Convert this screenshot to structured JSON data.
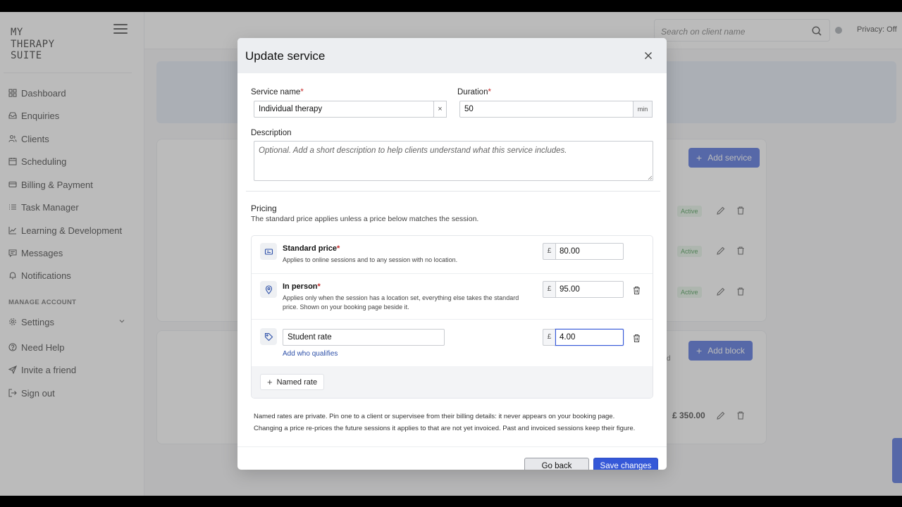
{
  "sidebar": {
    "logo": "MY\nTHERAPY\nSUITE",
    "items": [
      {
        "label": "Dashboard",
        "icon": "grid-icon"
      },
      {
        "label": "Enquiries",
        "icon": "inbox-icon"
      },
      {
        "label": "Clients",
        "icon": "users-icon"
      },
      {
        "label": "Scheduling",
        "icon": "calendar-icon"
      },
      {
        "label": "Billing & Payment",
        "icon": "card-icon"
      },
      {
        "label": "Task Manager",
        "icon": "list-icon"
      },
      {
        "label": "Learning & Development",
        "icon": "chart-icon"
      },
      {
        "label": "Messages",
        "icon": "message-icon"
      },
      {
        "label": "Notifications",
        "icon": "bell-icon"
      }
    ],
    "manage_label": "MANAGE ACCOUNT",
    "account_items": [
      {
        "label": "Settings",
        "icon": "gear-icon"
      },
      {
        "label": "Need Help",
        "icon": "help-icon"
      },
      {
        "label": "Invite a friend",
        "icon": "send-icon"
      },
      {
        "label": "Sign out",
        "icon": "logout-icon"
      }
    ]
  },
  "topbar": {
    "search_placeholder": "Search on client name",
    "privacy": "Privacy: Off"
  },
  "background": {
    "add_service": "Add service",
    "add_block": "Add block",
    "badges": [
      "Active",
      "Active",
      "Active"
    ],
    "price": "£ 350.00",
    "partial_text": "d"
  },
  "modal": {
    "title": "Update service",
    "service_name_label": "Service name",
    "service_name_value": "Individual therapy",
    "duration_label": "Duration",
    "duration_value": "50",
    "duration_unit": "min",
    "description_label": "Description",
    "description_placeholder": "Optional. Add a short description to help clients understand what this service includes.",
    "pricing_title": "Pricing",
    "pricing_subtitle": "The standard price applies unless a price below matches the session.",
    "currency": "£",
    "rows": [
      {
        "title": "Standard price",
        "desc": "Applies to online sessions and to any session with no location.",
        "amount": "80.00"
      },
      {
        "title": "In person",
        "desc": "Applies only when the session has a location set, everything else takes the standard price. Shown on your booking page beside it.",
        "amount": "95.00"
      }
    ],
    "named_rate": {
      "name": "Student rate",
      "amount": "4.00",
      "add_link": "Add who qualifies"
    },
    "named_rate_button": "Named rate",
    "notes": [
      "Named rates are private. Pin one to a client or supervisee from their billing details: it never appears on your booking page.",
      "Changing a price re-prices the future sessions it applies to that are not yet invoiced. Past and invoiced sessions keep their figure."
    ],
    "go_back": "Go back",
    "save": "Save changes"
  },
  "colors": {
    "accent": "#3558d8",
    "required": "#c62828",
    "active_badge": "#2e8b3a"
  }
}
